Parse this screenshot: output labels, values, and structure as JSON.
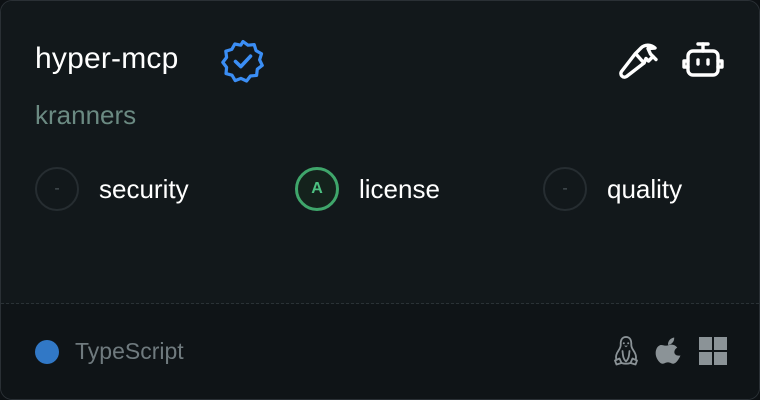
{
  "card": {
    "title": "hyper-mcp",
    "author": "kranners",
    "verified": true,
    "header_icons": [
      "hammer-icon",
      "robot-icon"
    ],
    "metrics": [
      {
        "label": "security",
        "grade": "-",
        "style": "empty"
      },
      {
        "label": "license",
        "grade": "A",
        "style": "grade-a"
      },
      {
        "label": "quality",
        "grade": "-",
        "style": "empty"
      }
    ],
    "footer": {
      "language": "TypeScript",
      "language_color": "#3178c6",
      "platforms": [
        "linux-icon",
        "apple-icon",
        "windows-icon"
      ]
    }
  },
  "colors": {
    "verified_blue": "#3b8ef5",
    "grade_a_green": "#3fa66b",
    "author_text": "#6b8a82"
  }
}
